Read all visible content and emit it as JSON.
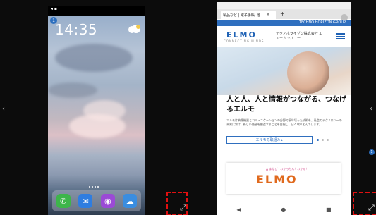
{
  "left_phone": {
    "clock": "14:35",
    "notification_badge": "1",
    "dock_apps": [
      {
        "name": "phone-app-icon",
        "glyph": "✆",
        "color": "#3db54a"
      },
      {
        "name": "mail-app-icon",
        "glyph": "✉",
        "color": "#2f7de0"
      },
      {
        "name": "podcasts-app-icon",
        "glyph": "◉",
        "color": "#9b4ad6"
      },
      {
        "name": "weather-app-icon",
        "glyph": "☁",
        "color": "#3a8de0"
      }
    ]
  },
  "right_phone": {
    "tab_title": "製品など | 電子手帳, 他...",
    "tab_close": "×",
    "tab_add": "+",
    "header_bar_text": "TECHNO HORIZON GROUP",
    "logo": "ELMO",
    "logo_tagline": "CONNECTING MINDS",
    "company_name": "テクノホライゾン株式会社 エルモカンパニー",
    "headline": "人と人、人と情報がつながる、つなげるエルモ",
    "body": "エルモは映像機器とコミュニケーションの分野で長年培った技術を、社会のテクノロジーの未来に繋げ、新しい価値を創造することを目指し、日々取り組んでいます。",
    "button_label": "エルモの取組み ▸",
    "card_tag": "▲ まなび・わかっちん！わかる！",
    "card_logo": "ELMO",
    "nav": {
      "back": "◀",
      "home": "●",
      "recent": "■"
    }
  },
  "overlay": {
    "left_arrow": "‹",
    "right_arrow": "‹",
    "expand_icon": "⤢",
    "edge_badge": "1"
  },
  "colors": {
    "accent_blue": "#1f62b5",
    "highlight_red": "#e01010"
  }
}
